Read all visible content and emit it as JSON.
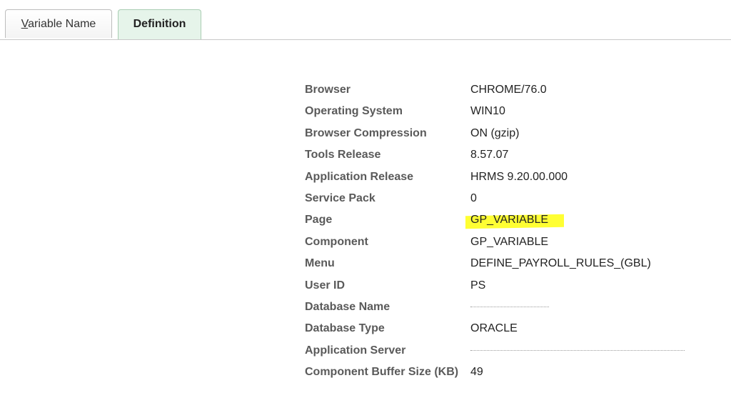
{
  "tabs": [
    {
      "label_accel": "V",
      "label_rest": "ariable Name"
    },
    {
      "label": "Definition"
    }
  ],
  "info_rows": [
    {
      "label": "Browser",
      "value": "CHROME/76.0"
    },
    {
      "label": "Operating System",
      "value": "WIN10"
    },
    {
      "label": "Browser Compression",
      "value": "ON (gzip)"
    },
    {
      "label": "Tools Release",
      "value": "8.57.07"
    },
    {
      "label": "Application Release",
      "value": "HRMS 9.20.00.000"
    },
    {
      "label": "Service Pack",
      "value": "0"
    },
    {
      "label": "Page",
      "value": "GP_VARIABLE"
    },
    {
      "label": "Component",
      "value": "GP_VARIABLE"
    },
    {
      "label": "Menu",
      "value": "DEFINE_PAYROLL_RULES_(GBL)"
    },
    {
      "label": "User ID",
      "value": "PS"
    },
    {
      "label": "Database Name",
      "value": ""
    },
    {
      "label": "Database Type",
      "value": "ORACLE"
    },
    {
      "label": "Application Server",
      "value": ""
    },
    {
      "label": "Component Buffer Size (KB)",
      "value": "49"
    }
  ],
  "colors": {
    "highlight": "#ffff33",
    "active_tab": "#e6f4ea"
  }
}
